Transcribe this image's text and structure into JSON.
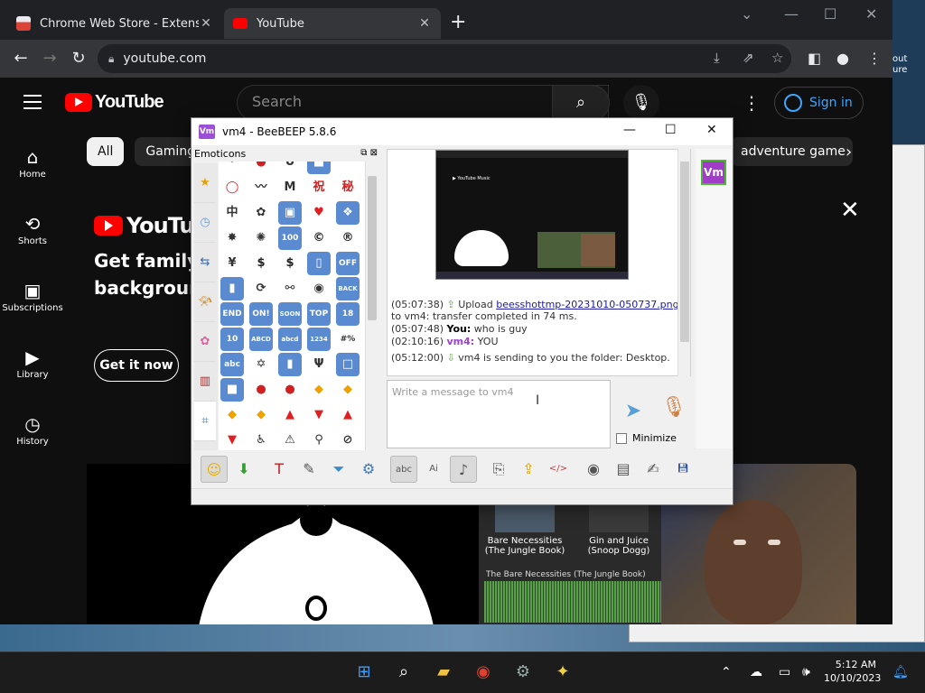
{
  "browser": {
    "tabs": [
      {
        "title": "Chrome Web Store - Extensions",
        "favicon_color": "#e8eaed"
      },
      {
        "title": "YouTube",
        "favicon_color": "#ff0000"
      }
    ],
    "new_tab_glyph": "+",
    "url": "youtube.com",
    "window_controls": [
      "chevron-down-icon",
      "minimize-icon",
      "maximize-icon",
      "close-icon"
    ]
  },
  "youtube": {
    "logo_text": "YouTube",
    "search_placeholder": "Search",
    "signin_label": "Sign in",
    "nav": [
      {
        "label": "Home",
        "icon": "home-icon"
      },
      {
        "label": "Shorts",
        "icon": "shorts-icon"
      },
      {
        "label": "Subscriptions",
        "icon": "subscriptions-icon"
      },
      {
        "label": "Library",
        "icon": "library-icon"
      },
      {
        "label": "History",
        "icon": "history-icon"
      }
    ],
    "chips": [
      "All",
      "Gaming",
      "adventure game"
    ],
    "banner": {
      "logo_text": "YouTube",
      "headline_line1": "Get family",
      "headline_line2": "background",
      "cta": "Get it now"
    },
    "music_cards": [
      {
        "title": "Bare Necessities (The Jungle Book)"
      },
      {
        "title": "Gin and Juice (Snoop Dogg)"
      }
    ],
    "waveform_label": "The Bare Necessities (The Jungle Book)"
  },
  "beebeep": {
    "title": "vm4 - BeeBEEP 5.8.6",
    "app_icon_text": "Vm",
    "emoticons_label": "Emoticons",
    "emoticon_grid": [
      [
        "·",
        "●",
        "U",
        "■",
        ""
      ],
      [
        "◯",
        "〰",
        "M",
        "祝",
        "秘"
      ],
      [
        "中",
        "✿",
        "▣",
        "♥",
        "❖"
      ],
      [
        "✸",
        "✺",
        "100",
        "©",
        "®"
      ],
      [
        "¥",
        "$",
        "$",
        "▯",
        "OFF"
      ],
      [
        "▮",
        "⟳",
        "⚯",
        "◉",
        "BACK"
      ],
      [
        "END",
        "ON!",
        "SOON",
        "TOP",
        "18"
      ],
      [
        "10",
        "ABCD",
        "abcd",
        "1234",
        "#%"
      ],
      [
        "abc",
        "✡",
        "▮",
        "Ψ",
        "□"
      ],
      [
        "■",
        "●",
        "●",
        "◆",
        "◆"
      ],
      [
        "◆",
        "◆",
        "▲",
        "▼",
        "▲"
      ],
      [
        "▼",
        "♿",
        "⚠",
        "⚲",
        "⊘"
      ]
    ],
    "messages": [
      {
        "time": "(05:07:38)",
        "pre": "Upload ",
        "link": "beesshottmp-20231010-050737.png",
        "post": " to vm4: transfer completed in 74 ms."
      },
      {
        "time": "(05:07:48)",
        "who": "You:",
        "text": " who is guy"
      },
      {
        "time": "(02:10:16)",
        "who": "vm4:",
        "text": " YOU"
      },
      {
        "time": "(05:12:00)",
        "text": "vm4 is sending to you the folder: Desktop."
      }
    ],
    "input_placeholder": "Write a message to vm4",
    "minimize_label": "Minimize",
    "user_avatar": "Vm",
    "toolbar_icons": [
      "smiley-icon",
      "green-arrow-icon",
      "text-format-icon",
      "color-picker-icon",
      "filter-icon",
      "settings-gear-icon",
      "spellcheck-icon",
      "ai-icon",
      "music-note-icon",
      "send-file-icon",
      "send-folder-icon",
      "code-icon",
      "screenshot-icon",
      "film-icon",
      "notes-icon",
      "save-icon"
    ]
  },
  "peek": {
    "text_line1": "out",
    "text_line2": "ure"
  },
  "taskbar": {
    "apps": [
      "windows-start-icon",
      "search-icon",
      "file-explorer-icon",
      "chrome-icon",
      "settings-icon",
      "beebeep-icon"
    ],
    "time": "5:12 AM",
    "date": "10/10/2023"
  },
  "colors": {
    "youtube_red": "#ff0000",
    "signin_blue": "#3ea6ff",
    "beebeep_purple": "#a040d0"
  }
}
